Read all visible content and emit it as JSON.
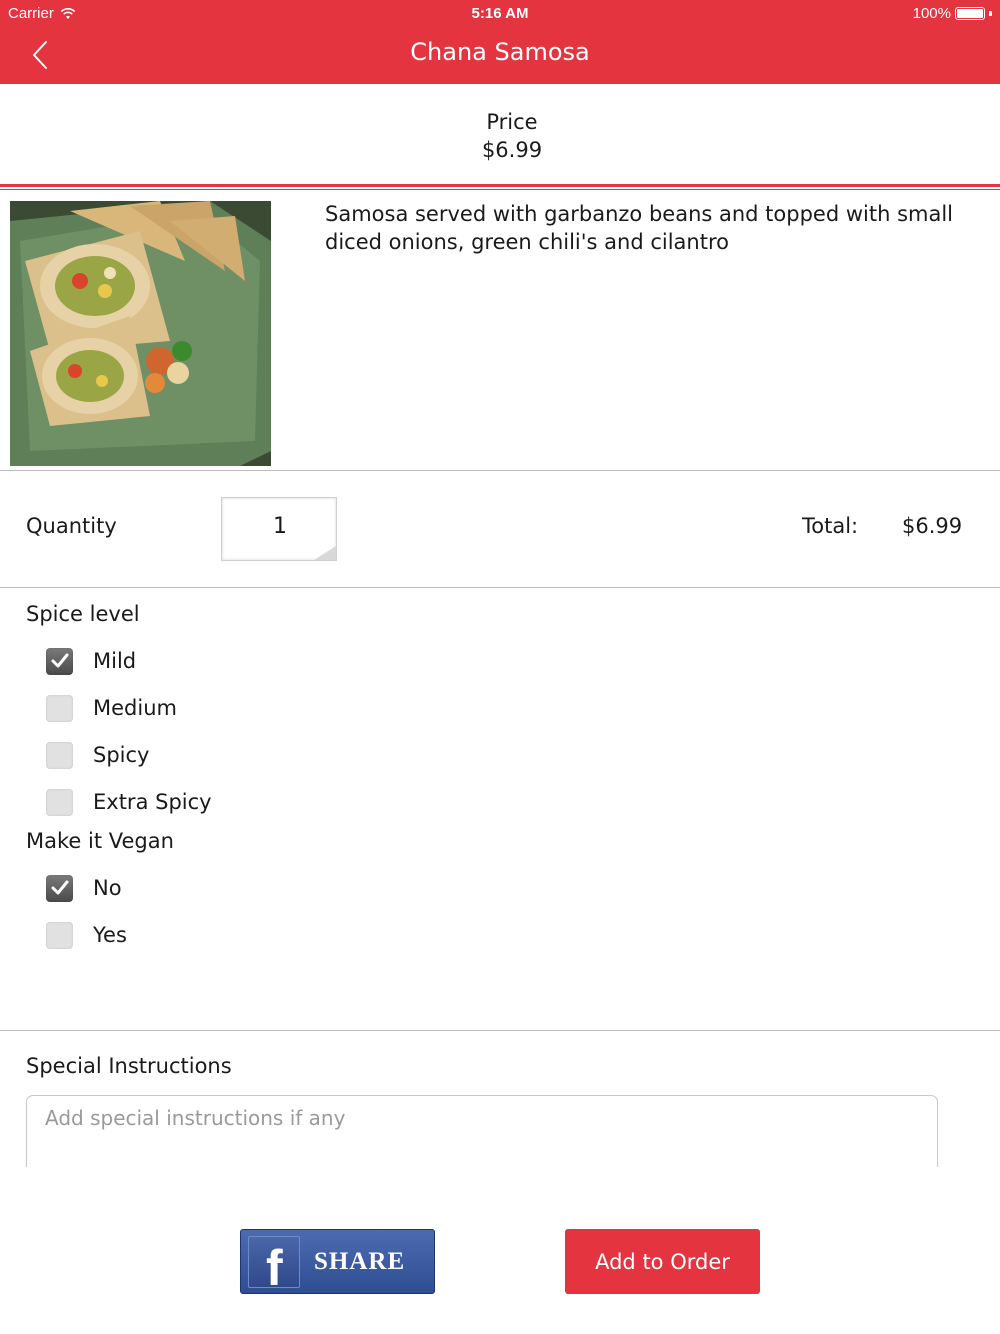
{
  "status_bar": {
    "carrier": "Carrier",
    "time": "5:16 AM",
    "battery": "100%"
  },
  "nav": {
    "title": "Chana Samosa"
  },
  "price": {
    "label": "Price",
    "value": "$6.99"
  },
  "item": {
    "description": "Samosa served with garbanzo beans and topped with small diced onions, green chili's and cilantro"
  },
  "quantity": {
    "label": "Quantity",
    "value": "1"
  },
  "total": {
    "label": "Total:",
    "value": "$6.99"
  },
  "spice": {
    "title": "Spice level",
    "options": [
      {
        "label": "Mild",
        "checked": true
      },
      {
        "label": "Medium",
        "checked": false
      },
      {
        "label": "Spicy",
        "checked": false
      },
      {
        "label": "Extra Spicy",
        "checked": false
      }
    ]
  },
  "vegan": {
    "title": "Make it Vegan",
    "options": [
      {
        "label": "No",
        "checked": true
      },
      {
        "label": "Yes",
        "checked": false
      }
    ]
  },
  "special": {
    "title": "Special Instructions",
    "placeholder": "Add special instructions if any"
  },
  "actions": {
    "share_label": "SHARE",
    "add_label": "Add to Order"
  },
  "colors": {
    "accent": "#e4343f",
    "facebook": "#3b5998"
  }
}
